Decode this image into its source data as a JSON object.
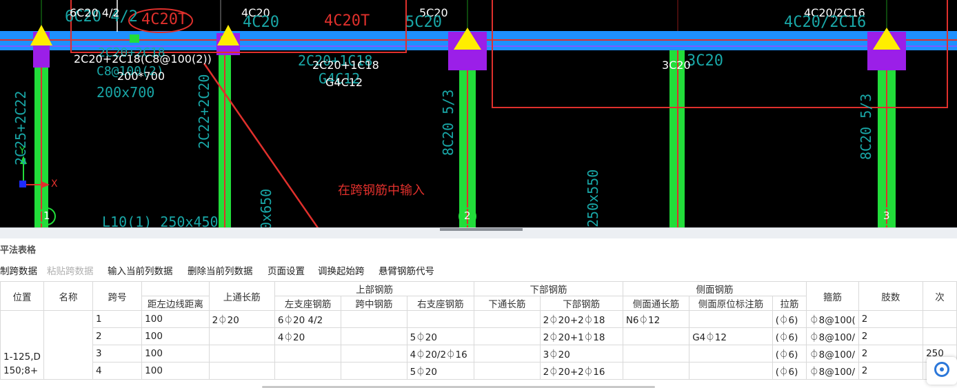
{
  "cad": {
    "labels": {
      "top_left": "6C20 4/2",
      "circled": "4C20T",
      "span2_top": "4C20",
      "span2_top_ghost": "4C20",
      "span2_mid": "4C20T",
      "col2_top": "5C20",
      "col2_top_ghost": "5C20",
      "right_top": "4C20/2C16",
      "right_top_ghost": "4C20/2C16",
      "beam_note1": "2C20+2C18(C8@100(2))",
      "beam_note2": "200*700",
      "beam_ghost1": "2C20+2C18",
      "beam_ghost2": "C8@100(2)",
      "beam_ghost3": "200x700",
      "span2_bottom1": "2C20+1C18",
      "span2_bottom2": "G4C12",
      "span2_ghost1": "2C20+1C18",
      "span2_ghost2": "G4C12",
      "span3_bottom": "3C20",
      "span3_ghost": "3C20",
      "col_a": "2C25+2C22",
      "col_b": "2C22+2C20",
      "col_c": "8C20 5/3",
      "col_d": "8C20 5/3",
      "col_e": "250x550",
      "col_f": "0x650",
      "bottom_ghost": "L10(1) 250x450",
      "annotation": "在跨钢筋中输入",
      "axis_1": "1",
      "axis_2": "2",
      "axis_3": "3",
      "axis_x": "X",
      "axis_y": "Y"
    },
    "colors": {
      "background": "#000000",
      "beam": "#1e90ff",
      "column": "#22dd3a",
      "support": "#9b1fe8",
      "marker": "#ffee00",
      "annotation": "#e0302c",
      "ghost_text": "#19a7a7"
    }
  },
  "panel": {
    "title": "平法表格",
    "toolbar": [
      {
        "label": "制跨数据",
        "enabled": true
      },
      {
        "label": "粘贴跨数据",
        "enabled": false
      },
      {
        "label": "输入当前列数据",
        "enabled": true
      },
      {
        "label": "删除当前列数据",
        "enabled": true
      },
      {
        "label": "页面设置",
        "enabled": true
      },
      {
        "label": "调换起始跨",
        "enabled": true
      },
      {
        "label": "悬臂钢筋代号",
        "enabled": true
      }
    ],
    "table": {
      "headers": {
        "position": "位置",
        "name": "名称",
        "span_no": "跨号",
        "dist_left": "距左边线距离",
        "top_through": "上通长筋",
        "top_group": "上部钢筋",
        "left_support": "左支座钢筋",
        "mid_span": "跨中钢筋",
        "right_support": "右支座钢筋",
        "bottom_group": "下部钢筋",
        "bottom_through": "下通长筋",
        "bottom_bars": "下部钢筋",
        "side_group": "侧面钢筋",
        "side_through": "侧面通长筋",
        "side_in_situ": "侧面原位标注筋",
        "tie": "拉筋",
        "stirrup": "箍筋",
        "legs": "肢数",
        "next": "次"
      },
      "position_value_1": "1-125,D",
      "position_value_2": "150;8+",
      "rows": [
        {
          "span": "1",
          "dist": "100",
          "top_through": "2⏀20",
          "left": "6⏀20 4/2",
          "mid": "",
          "right": "",
          "bot_through": "",
          "bottom": "2⏀20+2⏀18",
          "side_through": "N6⏀12",
          "side_in_situ": "",
          "tie": "(⏀6)",
          "stirrup": "⏀8@100(",
          "legs": "2",
          "next": ""
        },
        {
          "span": "2",
          "dist": "100",
          "top_through": "",
          "left": "4⏀20",
          "mid": "",
          "right": "5⏀20",
          "bot_through": "",
          "bottom": "2⏀20+1⏀18",
          "side_through": "",
          "side_in_situ": "G4⏀12",
          "tie": "(⏀6)",
          "stirrup": "⏀8@100/",
          "legs": "2",
          "next": ""
        },
        {
          "span": "3",
          "dist": "100",
          "top_through": "",
          "left": "",
          "mid": "",
          "right": "4⏀20/2⏀16",
          "bot_through": "",
          "bottom": "3⏀20",
          "side_through": "",
          "side_in_situ": "",
          "tie": "(⏀6)",
          "stirrup": "⏀8@100/",
          "legs": "2",
          "next": "250"
        },
        {
          "span": "4",
          "dist": "100",
          "top_through": "",
          "left": "",
          "mid": "",
          "right": "5⏀20",
          "bot_through": "",
          "bottom": "2⏀20+2⏀16",
          "side_through": "",
          "side_in_situ": "",
          "tie": "(⏀6)",
          "stirrup": "⏀8@100/",
          "legs": "2",
          "next": ""
        }
      ]
    }
  }
}
